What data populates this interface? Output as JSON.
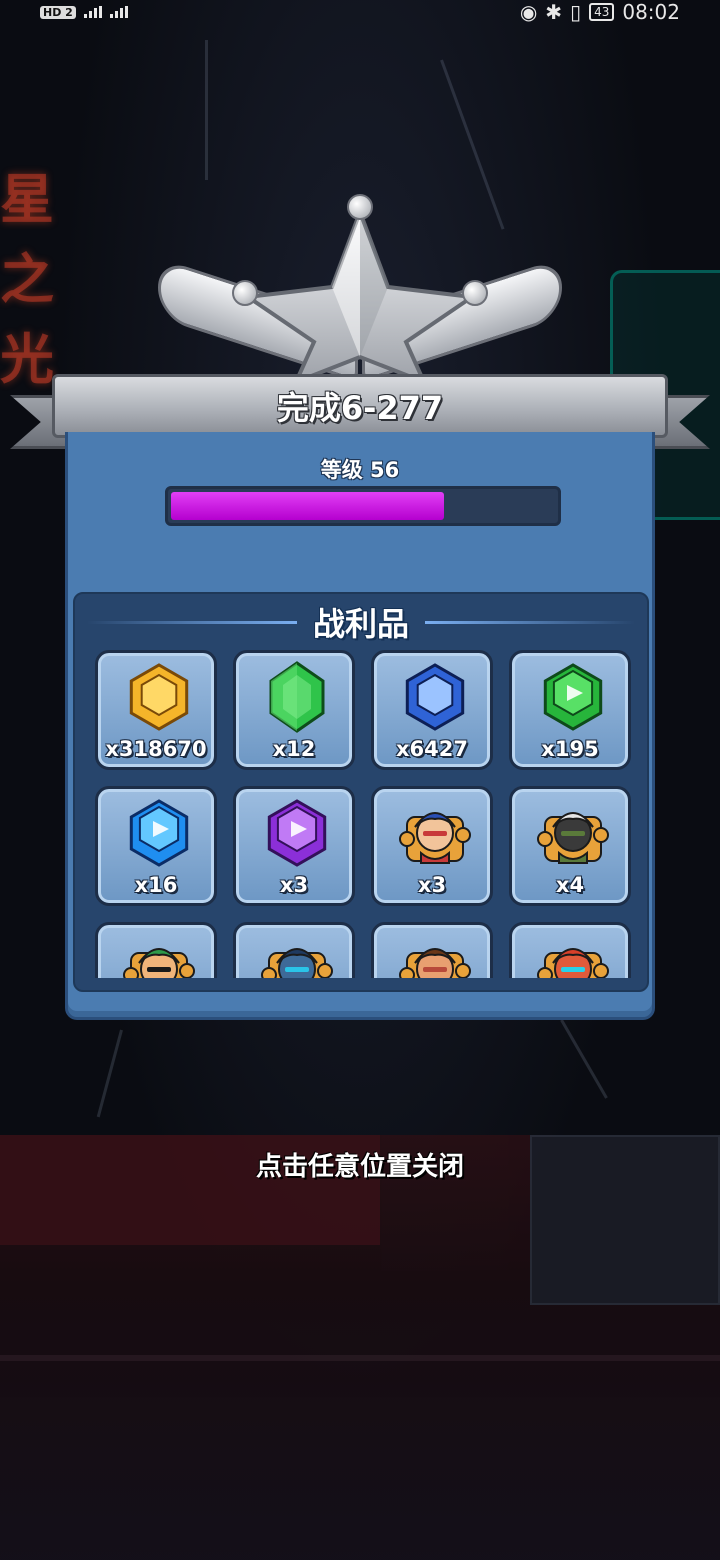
{
  "status_bar": {
    "hd_label": "HD 2",
    "battery": "43",
    "time": "08:02"
  },
  "result": {
    "title": "完成6-277",
    "level_label": "等级 56",
    "xp_progress_percent": 71,
    "loot_title": "战利品",
    "close_hint": "点击任意位置关闭"
  },
  "loot": [
    {
      "icon": "gold-coin-icon",
      "qty": "x318670"
    },
    {
      "icon": "green-gem-icon",
      "qty": "x12"
    },
    {
      "icon": "blue-token-icon",
      "qty": "x6427"
    },
    {
      "icon": "green-ticket-icon",
      "qty": "x195"
    },
    {
      "icon": "blue-ticket-icon",
      "qty": "x16"
    },
    {
      "icon": "purple-ticket-icon",
      "qty": "x3"
    },
    {
      "icon": "hero-red-hair-puzzle-icon",
      "qty": "x3"
    },
    {
      "icon": "hero-masked-puzzle-icon",
      "qty": "x4"
    },
    {
      "icon": "hero-green-hair-puzzle-icon",
      "qty": ""
    },
    {
      "icon": "hero-blue-cat-puzzle-icon",
      "qty": ""
    },
    {
      "icon": "hero-brown-hair-puzzle-icon",
      "qty": ""
    },
    {
      "icon": "hero-red-robot-puzzle-icon",
      "qty": ""
    }
  ],
  "colors": {
    "panel": "#4b7cb1",
    "loot_box": "#27456c",
    "xp_fill": "#d21ee8"
  }
}
